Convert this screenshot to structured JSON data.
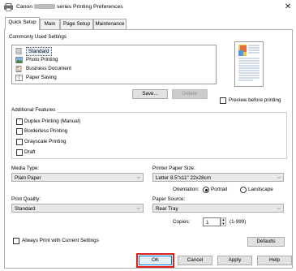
{
  "window": {
    "title_prefix": "Canon",
    "title_suffix": "series Printing Preferences",
    "close_glyph": "✕"
  },
  "tabs": [
    {
      "label": "Quick Setup",
      "active": true
    },
    {
      "label": "Main",
      "active": false
    },
    {
      "label": "Page Setup",
      "active": false
    },
    {
      "label": "Maintenance",
      "active": false
    }
  ],
  "common_settings": {
    "heading": "Commonly Used Settings",
    "items": [
      {
        "label": "Standard",
        "icon": "standard-icon",
        "selected": true
      },
      {
        "label": "Photo Printing",
        "icon": "photo-icon",
        "selected": false
      },
      {
        "label": "Business Document",
        "icon": "document-icon",
        "selected": false
      },
      {
        "label": "Paper Saving",
        "icon": "paper-saving-icon",
        "selected": false
      }
    ],
    "save_label": "Save...",
    "delete_label": "Delete"
  },
  "preview": {
    "label": "Preview before printing",
    "checked": false
  },
  "additional_features": {
    "heading": "Additional Features",
    "items": [
      {
        "label": "Duplex Printing (Manual)",
        "checked": false
      },
      {
        "label": "Borderless Printing",
        "checked": false
      },
      {
        "label": "Grayscale Printing",
        "checked": false
      },
      {
        "label": "Draft",
        "checked": false
      }
    ]
  },
  "media_type": {
    "label": "Media Type:",
    "value": "Plain Paper"
  },
  "paper_size": {
    "label": "Printer Paper Size:",
    "value": "Letter 8.5\"x11\" 22x28cm"
  },
  "orientation": {
    "label": "Orientation:",
    "portrait": "Portrait",
    "landscape": "Landscape",
    "selected": "Portrait"
  },
  "print_quality": {
    "label": "Print Quality:",
    "value": "Standard"
  },
  "paper_source": {
    "label": "Paper Source:",
    "value": "Rear Tray"
  },
  "copies": {
    "label": "Copies:",
    "value": "1",
    "range": "(1-999)"
  },
  "always_print": {
    "label": "Always Print with Current Settings",
    "checked": false
  },
  "buttons": {
    "defaults": "Defaults",
    "ok": "OK",
    "cancel": "Cancel",
    "apply": "Apply",
    "help": "Help"
  },
  "colors": {
    "accent_highlight": "#e0201c",
    "selection": "#e5f1fb"
  }
}
